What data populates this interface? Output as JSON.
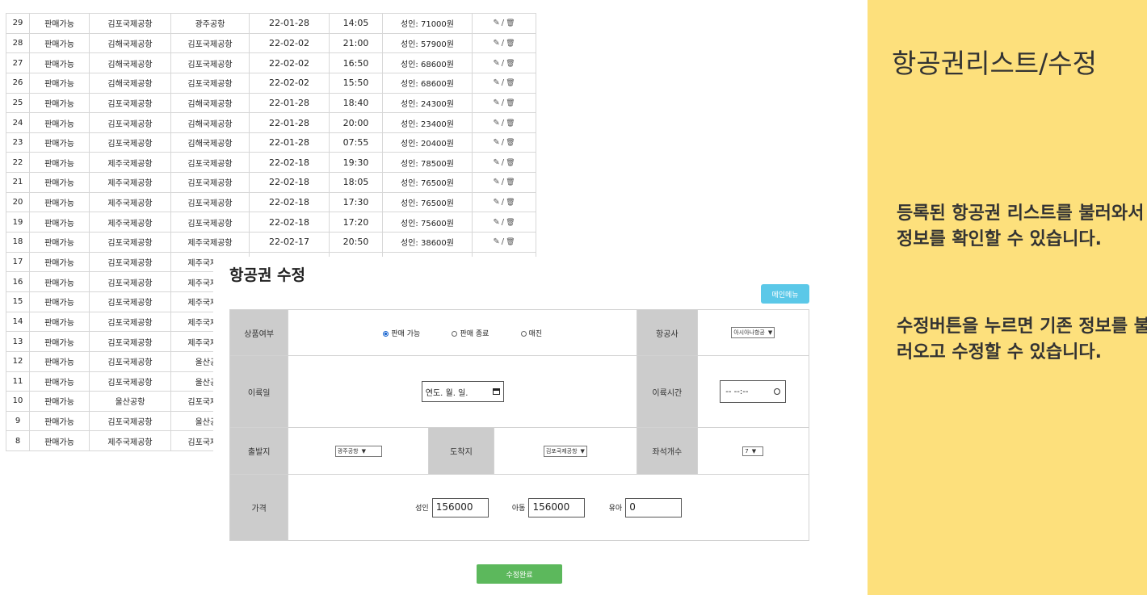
{
  "list": {
    "edit_icon": "✎",
    "sep": "/",
    "delete_icon": "🗑",
    "rows": [
      [
        "29",
        "판매가능",
        "김포국제공항",
        "광주공항",
        "22-01-28",
        "14:05",
        "성인: 71000원"
      ],
      [
        "28",
        "판매가능",
        "김해국제공항",
        "김포국제공항",
        "22-02-02",
        "21:00",
        "성인: 57900원"
      ],
      [
        "27",
        "판매가능",
        "김해국제공항",
        "김포국제공항",
        "22-02-02",
        "16:50",
        "성인: 68600원"
      ],
      [
        "26",
        "판매가능",
        "김해국제공항",
        "김포국제공항",
        "22-02-02",
        "15:50",
        "성인: 68600원"
      ],
      [
        "25",
        "판매가능",
        "김포국제공항",
        "김해국제공항",
        "22-01-28",
        "18:40",
        "성인: 24300원"
      ],
      [
        "24",
        "판매가능",
        "김포국제공항",
        "김해국제공항",
        "22-01-28",
        "20:00",
        "성인: 23400원"
      ],
      [
        "23",
        "판매가능",
        "김포국제공항",
        "김해국제공항",
        "22-01-28",
        "07:55",
        "성인: 20400원"
      ],
      [
        "22",
        "판매가능",
        "제주국제공항",
        "김포국제공항",
        "22-02-18",
        "19:30",
        "성인: 78500원"
      ],
      [
        "21",
        "판매가능",
        "제주국제공항",
        "김포국제공항",
        "22-02-18",
        "18:05",
        "성인: 76500원"
      ],
      [
        "20",
        "판매가능",
        "제주국제공항",
        "김포국제공항",
        "22-02-18",
        "17:30",
        "성인: 76500원"
      ],
      [
        "19",
        "판매가능",
        "제주국제공항",
        "김포국제공항",
        "22-02-18",
        "17:20",
        "성인: 75600원"
      ],
      [
        "18",
        "판매가능",
        "김포국제공항",
        "제주국제공항",
        "22-02-17",
        "20:50",
        "성인: 38600원"
      ],
      [
        "17",
        "판매가능",
        "김포국제공항",
        "제주국제공항",
        "",
        "",
        ""
      ],
      [
        "16",
        "판매가능",
        "김포국제공항",
        "제주국제공항",
        "",
        "",
        ""
      ],
      [
        "15",
        "판매가능",
        "김포국제공항",
        "제주국제공항",
        "",
        "",
        ""
      ],
      [
        "14",
        "판매가능",
        "김포국제공항",
        "제주국제공항",
        "",
        "",
        ""
      ],
      [
        "13",
        "판매가능",
        "김포국제공항",
        "제주국제공항",
        "",
        "",
        ""
      ],
      [
        "12",
        "판매가능",
        "김포국제공항",
        "울산공항",
        "",
        "",
        ""
      ],
      [
        "11",
        "판매가능",
        "김포국제공항",
        "울산공항",
        "",
        "",
        ""
      ],
      [
        "10",
        "판매가능",
        "울산공항",
        "김포국제공항",
        "",
        "",
        ""
      ],
      [
        "9",
        "판매가능",
        "김포국제공항",
        "울산공항",
        "",
        "",
        ""
      ],
      [
        "8",
        "판매가능",
        "제주국제공항",
        "김포국제공항",
        "",
        "",
        ""
      ]
    ]
  },
  "edit_form": {
    "title": "항공권 수정",
    "main_menu_label": "메인메뉴",
    "status_label": "상품여부",
    "status_options": [
      "판매 가능",
      "판매 종료",
      "매진"
    ],
    "status_selected": "판매 가능",
    "airline_label": "항공사",
    "airline_value": "아시아나항공",
    "departure_date_label": "이륙일",
    "departure_date_placeholder": "연도. 월. 일.",
    "departure_time_label": "이륙시간",
    "departure_time_placeholder": "-- --:--",
    "origin_label": "출발지",
    "origin_value": "광주공항",
    "destination_label": "도착지",
    "destination_value": "김포국제공항",
    "seats_label": "좌석개수",
    "seats_value": "7",
    "price_label": "가격",
    "adult_label": "성인",
    "adult_price": "156000",
    "child_label": "아동",
    "child_price": "156000",
    "infant_label": "유아",
    "infant_price": "0",
    "submit_label": "수정완료",
    "colors": {
      "main_menu": "#5bc8e8",
      "submit": "#5cb85c",
      "label_bg": "#cccccc"
    }
  },
  "panel": {
    "title": "항공권리스트/수정",
    "desc1": "등록된 항공권 리스트를 불러와서 정보를 확인할 수 있습니다.",
    "desc2": "수정버튼을 누르면 기존 정보를 불러오고 수정할 수 있습니다.",
    "bg_color": "#fde07c"
  }
}
